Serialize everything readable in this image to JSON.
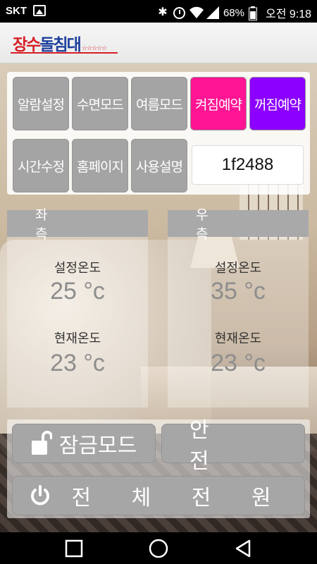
{
  "status_bar": {
    "carrier": "SKT",
    "battery_percent": "68%",
    "time": "오전 9:18",
    "icons": [
      "gallery-icon",
      "bluetooth-icon",
      "alarm-icon",
      "wifi-icon",
      "signal-icon",
      "battery-icon"
    ]
  },
  "header": {
    "logo_text_part1": "장수",
    "logo_text_part2": "돌침대",
    "logo_stars": "☆☆☆☆☆"
  },
  "buttons": {
    "alarm_setting": "알람설정",
    "sleep_mode": "수면모드",
    "summer_mode": "여름모드",
    "power_on_reserve": "켜짐예약",
    "power_off_reserve": "꺼짐예약",
    "time_adjust": "시간수정",
    "homepage": "홈페이지",
    "user_manual": "사용설명"
  },
  "device_code": "1f2488",
  "left_panel": {
    "title": "좌 측",
    "set_temp_label": "설정온도",
    "set_temp_value": "25 °c",
    "current_temp_label": "현재온도",
    "current_temp_value": "23 °c"
  },
  "right_panel": {
    "title": "우 측",
    "set_temp_label": "설정온도",
    "set_temp_value": "35 °c",
    "current_temp_label": "현재온도",
    "current_temp_value": "23 °c"
  },
  "controls": {
    "lock_mode": "잠금모드",
    "safety": "안 전",
    "all_power": "전 체 전 원"
  },
  "colors": {
    "button_gray": "#a4a4a4",
    "power_on_pink": "#ff1493",
    "power_off_purple": "#8b00ff",
    "logo_red": "#d61f26",
    "logo_blue": "#1d3f9c"
  }
}
